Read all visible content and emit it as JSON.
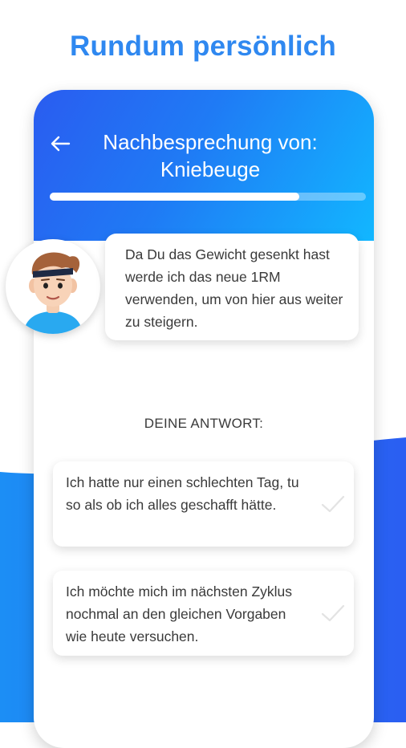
{
  "headline": "Rundum persönlich",
  "screen": {
    "title_line1": "Nachbesprechung von:",
    "title_line2": "Kniebeuge",
    "back_icon": "arrow-left-icon",
    "progress": 0.79
  },
  "coach": {
    "avatar_icon": "coach-avatar-icon",
    "message": "Da Du das Gewicht gesenkt hast werde ich das neue 1RM verwenden, um von hier aus weiter zu steigern."
  },
  "answers": {
    "heading": "DEINE ANTWORT:",
    "options": [
      {
        "text": "Ich hatte nur einen schlechten Tag, tu so als ob ich alles geschafft hätte.",
        "icon": "checkmark-icon"
      },
      {
        "text": "Ich möchte mich im nächsten Zyklus nochmal an den gleichen Vorgaben wie heute versuchen.",
        "icon": "checkmark-icon"
      }
    ]
  },
  "colors": {
    "accent": "#2f88f0",
    "header_gradient_start": "#2a5cf0",
    "header_gradient_end": "#12b7ff",
    "check_inactive": "#e3e3e3"
  }
}
